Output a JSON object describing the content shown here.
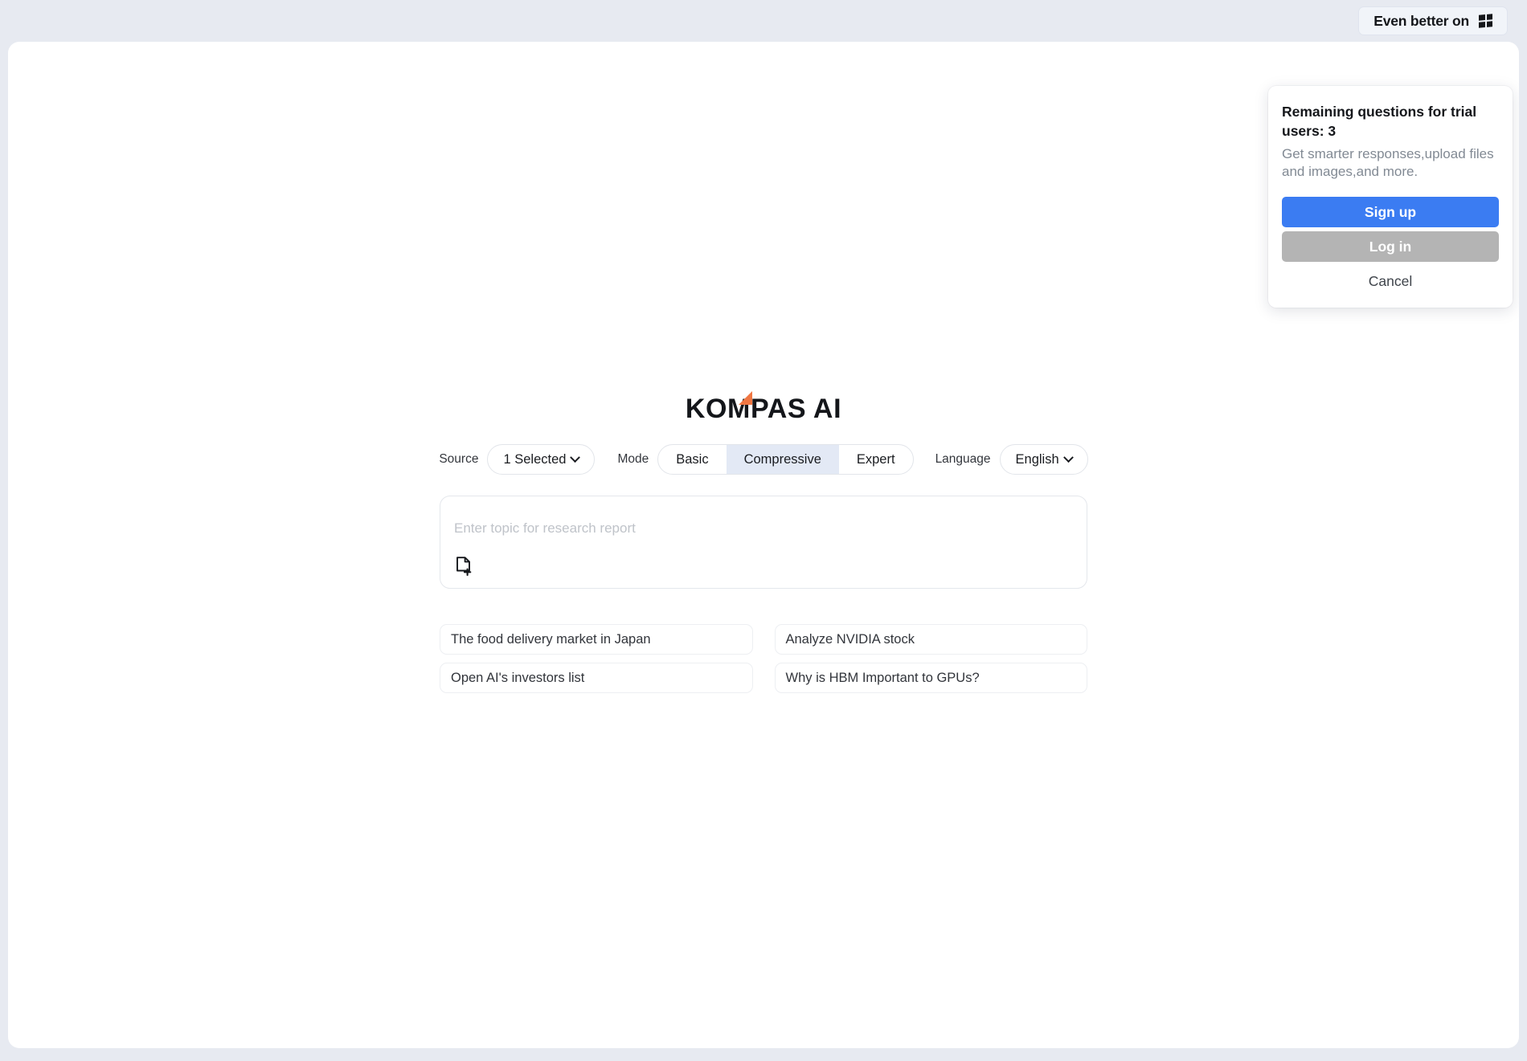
{
  "header": {
    "promo_button_label": "Even better on",
    "promo_icon": "windows-logo-icon"
  },
  "trial_popup": {
    "title": "Remaining questions for trial users: 3",
    "description": "Get smarter responses,upload files and images,and more.",
    "signup_label": "Sign up",
    "login_label": "Log in",
    "cancel_label": "Cancel",
    "signup_color": "#3b7cf2",
    "login_color": "#b4b4b4"
  },
  "brand": {
    "name": "KOMPAS AI",
    "accent_color": "#ef7642"
  },
  "controls": {
    "source_label": "Source",
    "source_value": "1 Selected",
    "mode_label": "Mode",
    "mode_options": [
      {
        "label": "Basic",
        "active": false
      },
      {
        "label": "Compressive",
        "active": true
      },
      {
        "label": "Expert",
        "active": false
      }
    ],
    "language_label": "Language",
    "language_value": "English",
    "active_segment_color": "#e3e9f5"
  },
  "prompt": {
    "placeholder": "Enter topic for research report",
    "value": "",
    "attach_icon": "file-add-icon"
  },
  "suggestions": [
    "The food delivery market in Japan",
    "Analyze NVIDIA stock",
    "Open AI's investors list",
    "Why is HBM Important to GPUs?"
  ]
}
